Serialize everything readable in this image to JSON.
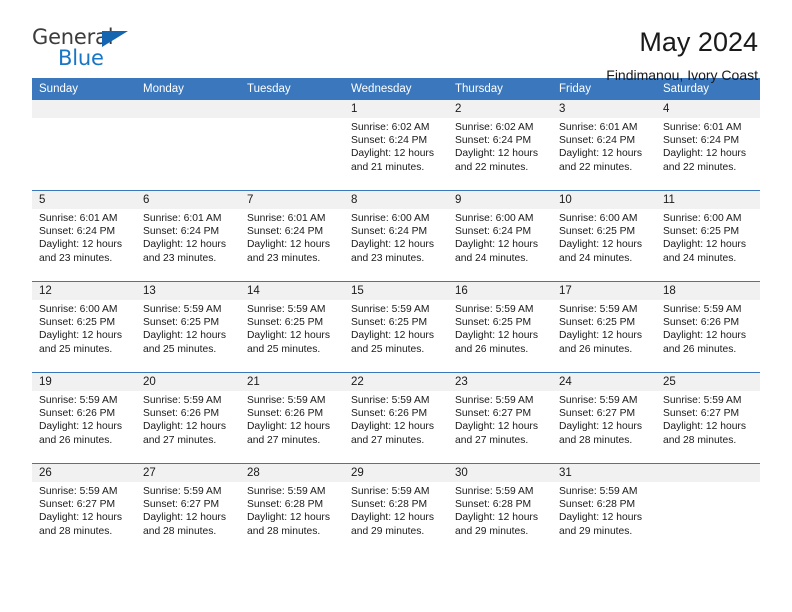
{
  "logo": {
    "word_one": "General",
    "word_two": "Blue",
    "triangle_icon": "triangle-icon",
    "brand_blue": "#1a76c4",
    "brand_dark": "#3c3c3c"
  },
  "header": {
    "title": "May 2024",
    "subtitle": "Findimanou, Ivory Coast",
    "header_bg": "#3b77bc",
    "daynum_bg": "#f1f1f1"
  },
  "weekday_headers": [
    "Sunday",
    "Monday",
    "Tuesday",
    "Wednesday",
    "Thursday",
    "Friday",
    "Saturday"
  ],
  "weeks": [
    [
      {
        "day": "",
        "sunrise": "",
        "sunset": "",
        "daylight_line1": "",
        "daylight_line2": ""
      },
      {
        "day": "",
        "sunrise": "",
        "sunset": "",
        "daylight_line1": "",
        "daylight_line2": ""
      },
      {
        "day": "",
        "sunrise": "",
        "sunset": "",
        "daylight_line1": "",
        "daylight_line2": ""
      },
      {
        "day": "1",
        "sunrise": "Sunrise: 6:02 AM",
        "sunset": "Sunset: 6:24 PM",
        "daylight_line1": "Daylight: 12 hours",
        "daylight_line2": "and 21 minutes."
      },
      {
        "day": "2",
        "sunrise": "Sunrise: 6:02 AM",
        "sunset": "Sunset: 6:24 PM",
        "daylight_line1": "Daylight: 12 hours",
        "daylight_line2": "and 22 minutes."
      },
      {
        "day": "3",
        "sunrise": "Sunrise: 6:01 AM",
        "sunset": "Sunset: 6:24 PM",
        "daylight_line1": "Daylight: 12 hours",
        "daylight_line2": "and 22 minutes."
      },
      {
        "day": "4",
        "sunrise": "Sunrise: 6:01 AM",
        "sunset": "Sunset: 6:24 PM",
        "daylight_line1": "Daylight: 12 hours",
        "daylight_line2": "and 22 minutes."
      }
    ],
    [
      {
        "day": "5",
        "sunrise": "Sunrise: 6:01 AM",
        "sunset": "Sunset: 6:24 PM",
        "daylight_line1": "Daylight: 12 hours",
        "daylight_line2": "and 23 minutes."
      },
      {
        "day": "6",
        "sunrise": "Sunrise: 6:01 AM",
        "sunset": "Sunset: 6:24 PM",
        "daylight_line1": "Daylight: 12 hours",
        "daylight_line2": "and 23 minutes."
      },
      {
        "day": "7",
        "sunrise": "Sunrise: 6:01 AM",
        "sunset": "Sunset: 6:24 PM",
        "daylight_line1": "Daylight: 12 hours",
        "daylight_line2": "and 23 minutes."
      },
      {
        "day": "8",
        "sunrise": "Sunrise: 6:00 AM",
        "sunset": "Sunset: 6:24 PM",
        "daylight_line1": "Daylight: 12 hours",
        "daylight_line2": "and 23 minutes."
      },
      {
        "day": "9",
        "sunrise": "Sunrise: 6:00 AM",
        "sunset": "Sunset: 6:24 PM",
        "daylight_line1": "Daylight: 12 hours",
        "daylight_line2": "and 24 minutes."
      },
      {
        "day": "10",
        "sunrise": "Sunrise: 6:00 AM",
        "sunset": "Sunset: 6:25 PM",
        "daylight_line1": "Daylight: 12 hours",
        "daylight_line2": "and 24 minutes."
      },
      {
        "day": "11",
        "sunrise": "Sunrise: 6:00 AM",
        "sunset": "Sunset: 6:25 PM",
        "daylight_line1": "Daylight: 12 hours",
        "daylight_line2": "and 24 minutes."
      }
    ],
    [
      {
        "day": "12",
        "sunrise": "Sunrise: 6:00 AM",
        "sunset": "Sunset: 6:25 PM",
        "daylight_line1": "Daylight: 12 hours",
        "daylight_line2": "and 25 minutes."
      },
      {
        "day": "13",
        "sunrise": "Sunrise: 5:59 AM",
        "sunset": "Sunset: 6:25 PM",
        "daylight_line1": "Daylight: 12 hours",
        "daylight_line2": "and 25 minutes."
      },
      {
        "day": "14",
        "sunrise": "Sunrise: 5:59 AM",
        "sunset": "Sunset: 6:25 PM",
        "daylight_line1": "Daylight: 12 hours",
        "daylight_line2": "and 25 minutes."
      },
      {
        "day": "15",
        "sunrise": "Sunrise: 5:59 AM",
        "sunset": "Sunset: 6:25 PM",
        "daylight_line1": "Daylight: 12 hours",
        "daylight_line2": "and 25 minutes."
      },
      {
        "day": "16",
        "sunrise": "Sunrise: 5:59 AM",
        "sunset": "Sunset: 6:25 PM",
        "daylight_line1": "Daylight: 12 hours",
        "daylight_line2": "and 26 minutes."
      },
      {
        "day": "17",
        "sunrise": "Sunrise: 5:59 AM",
        "sunset": "Sunset: 6:25 PM",
        "daylight_line1": "Daylight: 12 hours",
        "daylight_line2": "and 26 minutes."
      },
      {
        "day": "18",
        "sunrise": "Sunrise: 5:59 AM",
        "sunset": "Sunset: 6:26 PM",
        "daylight_line1": "Daylight: 12 hours",
        "daylight_line2": "and 26 minutes."
      }
    ],
    [
      {
        "day": "19",
        "sunrise": "Sunrise: 5:59 AM",
        "sunset": "Sunset: 6:26 PM",
        "daylight_line1": "Daylight: 12 hours",
        "daylight_line2": "and 26 minutes."
      },
      {
        "day": "20",
        "sunrise": "Sunrise: 5:59 AM",
        "sunset": "Sunset: 6:26 PM",
        "daylight_line1": "Daylight: 12 hours",
        "daylight_line2": "and 27 minutes."
      },
      {
        "day": "21",
        "sunrise": "Sunrise: 5:59 AM",
        "sunset": "Sunset: 6:26 PM",
        "daylight_line1": "Daylight: 12 hours",
        "daylight_line2": "and 27 minutes."
      },
      {
        "day": "22",
        "sunrise": "Sunrise: 5:59 AM",
        "sunset": "Sunset: 6:26 PM",
        "daylight_line1": "Daylight: 12 hours",
        "daylight_line2": "and 27 minutes."
      },
      {
        "day": "23",
        "sunrise": "Sunrise: 5:59 AM",
        "sunset": "Sunset: 6:27 PM",
        "daylight_line1": "Daylight: 12 hours",
        "daylight_line2": "and 27 minutes."
      },
      {
        "day": "24",
        "sunrise": "Sunrise: 5:59 AM",
        "sunset": "Sunset: 6:27 PM",
        "daylight_line1": "Daylight: 12 hours",
        "daylight_line2": "and 28 minutes."
      },
      {
        "day": "25",
        "sunrise": "Sunrise: 5:59 AM",
        "sunset": "Sunset: 6:27 PM",
        "daylight_line1": "Daylight: 12 hours",
        "daylight_line2": "and 28 minutes."
      }
    ],
    [
      {
        "day": "26",
        "sunrise": "Sunrise: 5:59 AM",
        "sunset": "Sunset: 6:27 PM",
        "daylight_line1": "Daylight: 12 hours",
        "daylight_line2": "and 28 minutes."
      },
      {
        "day": "27",
        "sunrise": "Sunrise: 5:59 AM",
        "sunset": "Sunset: 6:27 PM",
        "daylight_line1": "Daylight: 12 hours",
        "daylight_line2": "and 28 minutes."
      },
      {
        "day": "28",
        "sunrise": "Sunrise: 5:59 AM",
        "sunset": "Sunset: 6:28 PM",
        "daylight_line1": "Daylight: 12 hours",
        "daylight_line2": "and 28 minutes."
      },
      {
        "day": "29",
        "sunrise": "Sunrise: 5:59 AM",
        "sunset": "Sunset: 6:28 PM",
        "daylight_line1": "Daylight: 12 hours",
        "daylight_line2": "and 29 minutes."
      },
      {
        "day": "30",
        "sunrise": "Sunrise: 5:59 AM",
        "sunset": "Sunset: 6:28 PM",
        "daylight_line1": "Daylight: 12 hours",
        "daylight_line2": "and 29 minutes."
      },
      {
        "day": "31",
        "sunrise": "Sunrise: 5:59 AM",
        "sunset": "Sunset: 6:28 PM",
        "daylight_line1": "Daylight: 12 hours",
        "daylight_line2": "and 29 minutes."
      },
      {
        "day": "",
        "sunrise": "",
        "sunset": "",
        "daylight_line1": "",
        "daylight_line2": ""
      }
    ]
  ]
}
